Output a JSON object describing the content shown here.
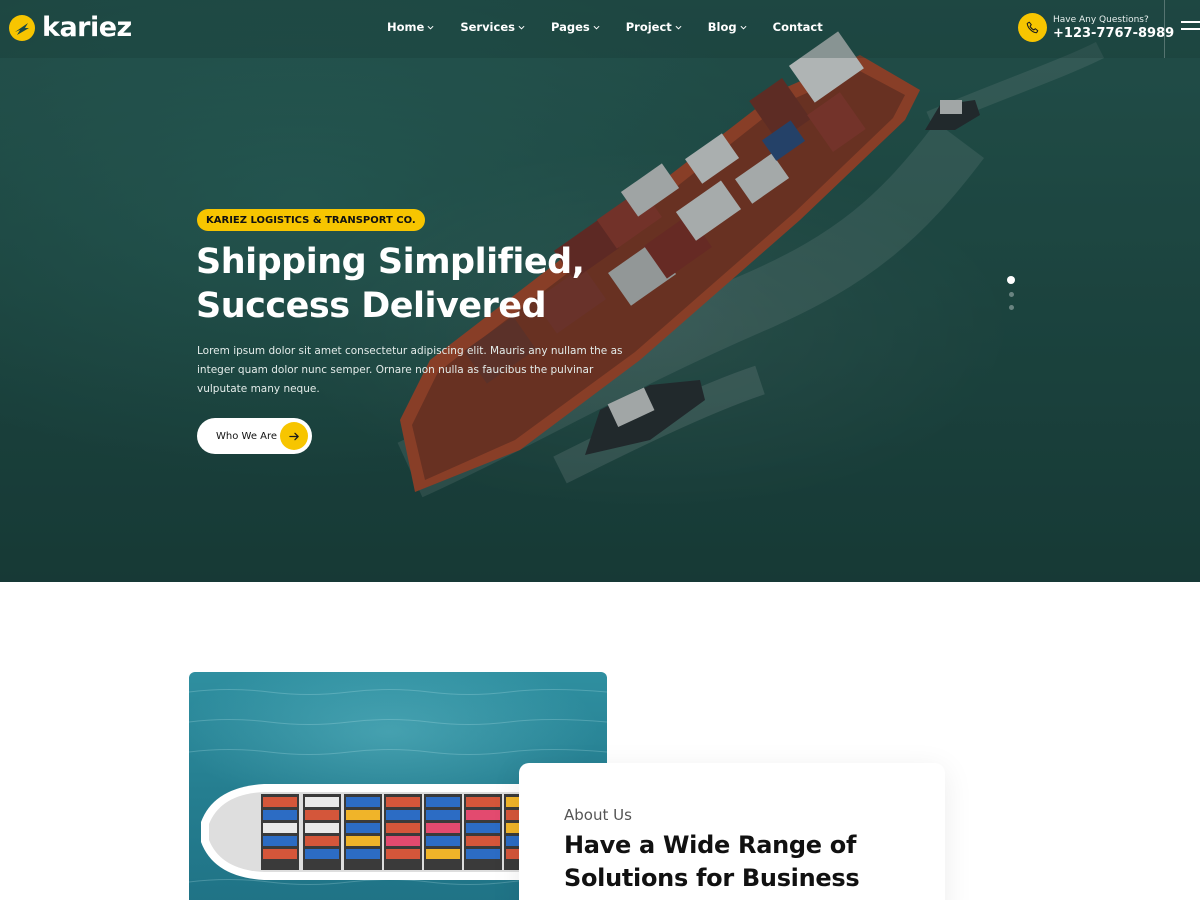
{
  "brand": {
    "name": "kariez",
    "accent": "#f7c500"
  },
  "nav": {
    "items": [
      {
        "label": "Home",
        "has_dropdown": true
      },
      {
        "label": "Services",
        "has_dropdown": true
      },
      {
        "label": "Pages",
        "has_dropdown": true
      },
      {
        "label": "Project",
        "has_dropdown": true
      },
      {
        "label": "Blog",
        "has_dropdown": true
      },
      {
        "label": "Contact",
        "has_dropdown": false
      }
    ],
    "contact_label": "Have Any Questions?",
    "contact_phone": "+123-7767-8989",
    "phone_icon": "phone-icon",
    "menu_icon": "hamburger-icon"
  },
  "hero": {
    "tag": "KARIEZ LOGISTICS & TRANSPORT CO.",
    "headline_line1": "Shipping Simplified,",
    "headline_line2": "Success Delivered",
    "description": "Lorem ipsum dolor sit amet consectetur adipiscing elit. Mauris any nullam the as integer quam dolor nunc semper. Ornare non nulla as faucibus the pulvinar vulputate many neque.",
    "cta_label": "Who We Are",
    "cta_icon": "arrow-right-icon",
    "slides": 3,
    "active_slide": 1
  },
  "about": {
    "label": "About Us",
    "title_line1": "Have a Wide Range of",
    "title_line2": "Solutions for Business"
  }
}
